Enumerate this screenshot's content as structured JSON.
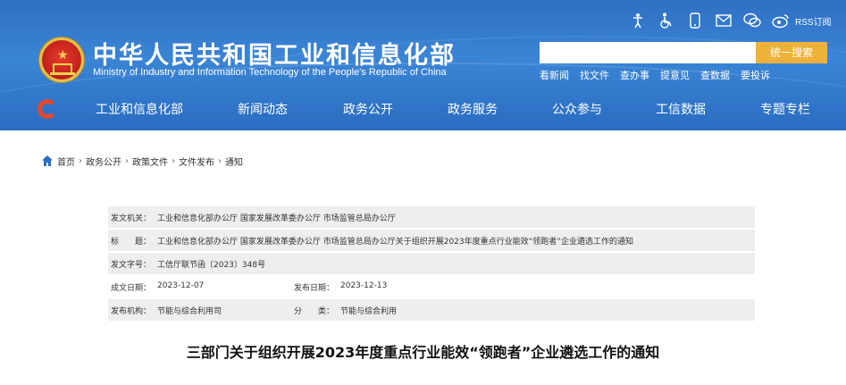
{
  "header": {
    "title_cn": "中华人民共和国工业和信息化部",
    "title_en": "Ministry of Industry and Information Technology of the People's Republic of China",
    "icons": [
      "accessibility-icon",
      "wheelchair-icon",
      "mobile-icon",
      "mail-icon",
      "wechat-icon",
      "weibo-icon"
    ],
    "rss_label": "RSS订阅",
    "search": {
      "placeholder": "",
      "button": "统一搜索"
    },
    "quick_links": [
      "看新闻",
      "找文件",
      "查办事",
      "提意见",
      "查数据",
      "要投诉"
    ],
    "nav": [
      "工业和信息化部",
      "新闻动态",
      "政务公开",
      "政务服务",
      "公众参与",
      "工信数据",
      "专题专栏"
    ]
  },
  "breadcrumb": [
    "首页",
    "政务公开",
    "政策文件",
    "文件发布",
    "通知"
  ],
  "info": {
    "issuer_label": "发文机关：",
    "issuer": "工业和信息化部办公厅 国家发展改革委办公厅 市场监管总局办公厅",
    "title_label": "标　　题：",
    "title": "工业和信息化部办公厅 国家发展改革委办公厅 市场监管总局办公厅关于组织开展2023年度重点行业能效“领跑者”企业遴选工作的通知",
    "doc_no_label": "发文字号：",
    "doc_no": "工信厅联节函〔2023〕348号",
    "date_label": "成文日期：",
    "date": "2023-12-07",
    "pub_date_label": "发布日期：",
    "pub_date": "2023-12-13",
    "org_label": "发布机构：",
    "org": "节能与综合利用司",
    "category_label": "分　　类：",
    "category": "节能与综合利用"
  },
  "doc_title": "三部门关于组织开展2023年度重点行业能效“领跑者”企业遴选工作的通知",
  "colors": {
    "header_blue": "#3a85d6",
    "search_button": "#f0b13a",
    "row_gray": "#eeeeee"
  }
}
